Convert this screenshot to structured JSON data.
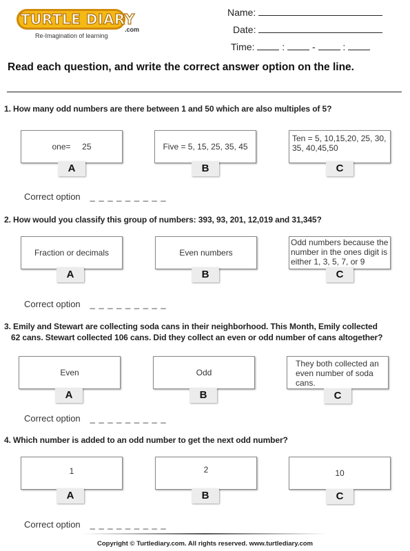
{
  "brand": {
    "name": "TURTLE DIARY",
    "suffix": ".com",
    "tagline": "Re-Imagination of learning",
    "colors": {
      "logo_fill": "#f5b915",
      "logo_outline": "#d08a0a"
    }
  },
  "header": {
    "name_label": "Name:",
    "date_label": "Date:",
    "time_label": "Time:",
    "time_sep1": ":",
    "time_dash": "-",
    "time_sep2": ":"
  },
  "instructions": "Read each question, and write the correct answer option on the line.",
  "correct_label": "Correct option",
  "correct_blank": "_ _ _ _ _ _ _ _ _",
  "questions": [
    {
      "text": "1. How many odd numbers are there between 1 and 50 which are also multiples of 5?",
      "options": [
        {
          "letter": "A",
          "text": "one=     25"
        },
        {
          "letter": "B",
          "text": "Five = 5, 15, 25, 35, 45"
        },
        {
          "letter": "C",
          "text": "Ten = 5, 10,15,20, 25, 30, 35, 40,45,50"
        }
      ]
    },
    {
      "text": "2. How would you classify this group of numbers: 393, 93, 201, 12,019 and 31,345?",
      "options": [
        {
          "letter": "A",
          "text": "Fraction or decimals"
        },
        {
          "letter": "B",
          "text": "Even numbers"
        },
        {
          "letter": "C",
          "text": "Odd numbers because the number in the ones digit is either 1, 3, 5, 7, or 9"
        }
      ]
    },
    {
      "text_line1": "3. Emily and Stewart are collecting soda cans in their neighborhood.  This Month, Emily collected",
      "text_line2": "62 cans.  Stewart collected 106 cans.  Did they collect an even or odd number of  cans altogether?",
      "options": [
        {
          "letter": "A",
          "text": "Even"
        },
        {
          "letter": "B",
          "text": "Odd"
        },
        {
          "letter": "C",
          "text": "They both collected an even number of soda cans."
        }
      ]
    },
    {
      "text": "4. Which number is added to an odd number to get the next odd number?",
      "options": [
        {
          "letter": "A",
          "text": "1"
        },
        {
          "letter": "B",
          "text": "2"
        },
        {
          "letter": "C",
          "text": "10"
        }
      ]
    }
  ],
  "footer": "Copyright © Turtlediary.com. All rights reserved. www.turtlediary.com"
}
